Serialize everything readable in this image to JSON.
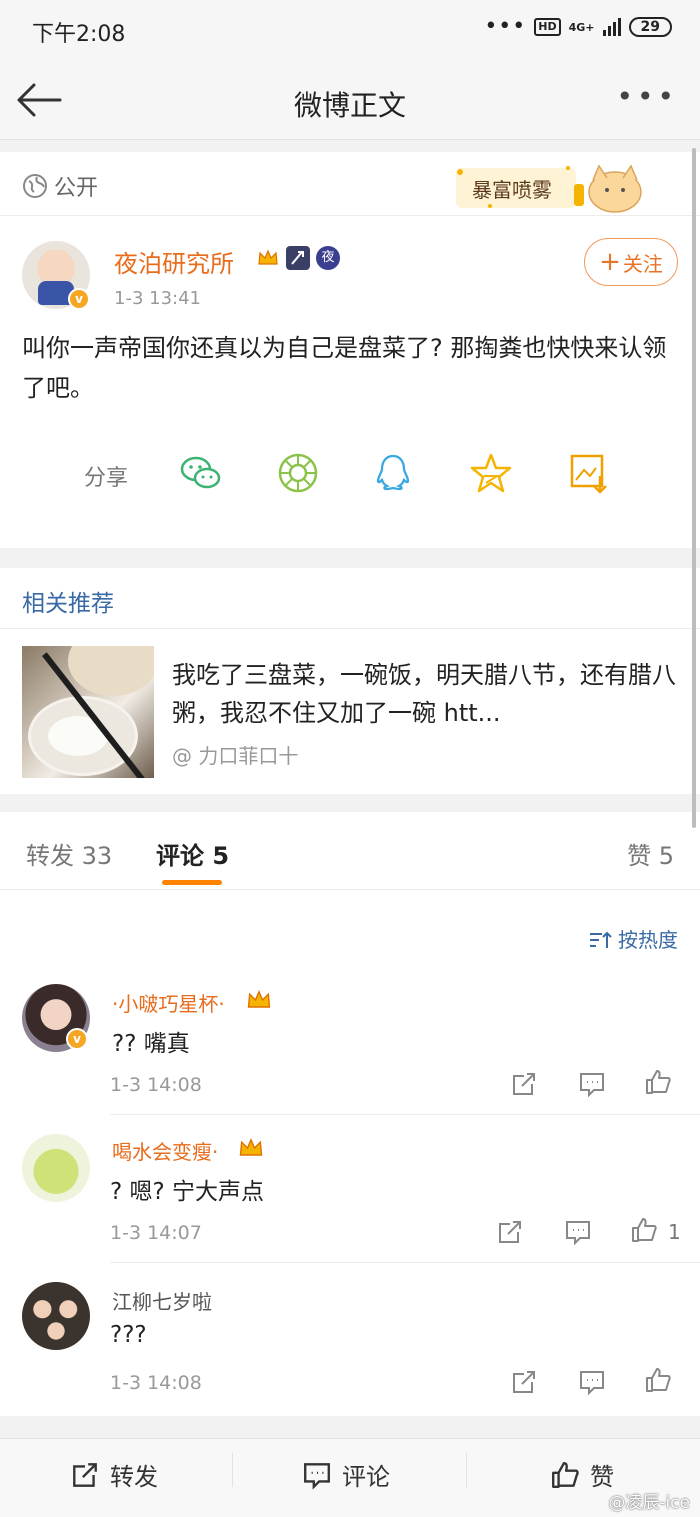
{
  "status_bar": {
    "time": "下午2:08",
    "network": "4G+",
    "hd": "HD",
    "battery": "29"
  },
  "nav": {
    "title": "微博正文"
  },
  "post": {
    "visibility": "公开",
    "banner_text": "暴富喷雾",
    "author": "夜泊研究所",
    "badge_night": "夜",
    "time": "1-3 13:41",
    "follow_label": "关注",
    "content": "叫你一声帝国你还真以为自己是盘菜了? 那掏粪也快快来认领了吧。",
    "share_label": "分享"
  },
  "related": {
    "title": "相关推荐",
    "text": "我吃了三盘菜，一碗饭，明天腊八节，还有腊八粥，我忍不住又加了一碗 htt...",
    "source": "@ 力口菲口十"
  },
  "tabs": [
    {
      "label": "转发 33"
    },
    {
      "label": "评论 5"
    },
    {
      "label": "赞 5"
    }
  ],
  "comments_section": {
    "sort_label": "按热度",
    "items": [
      {
        "name": "·小啵巧星杯·",
        "text": "?? 嘴真",
        "time": "1-3 14:08",
        "likes": ""
      },
      {
        "name": "喝水会变瘦·",
        "text": "? 嗯? 宁大声点",
        "time": "1-3 14:07",
        "likes": "1"
      },
      {
        "name": "江柳七岁啦",
        "text": "???",
        "time": "1-3 14:08",
        "likes": ""
      }
    ]
  },
  "bottom_bar": {
    "repost": "转发",
    "comment": "评论",
    "like": "赞"
  },
  "watermark": "@凌辰-ice",
  "colors": {
    "accent": "#ff8200",
    "name": "#e86c1c",
    "link": "#3a6aa6"
  }
}
